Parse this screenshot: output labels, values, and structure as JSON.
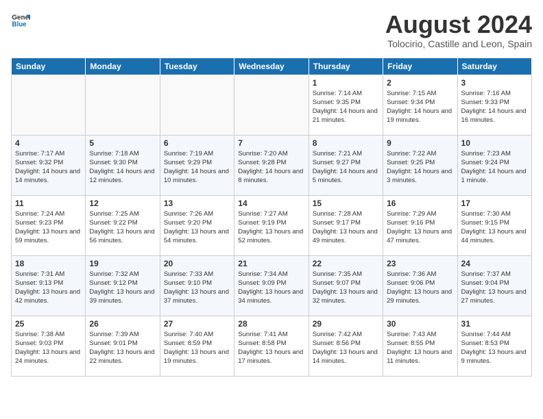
{
  "header": {
    "logo": "GeneralBlue",
    "month_title": "August 2024",
    "location": "Tolocirio, Castille and Leon, Spain"
  },
  "weekdays": [
    "Sunday",
    "Monday",
    "Tuesday",
    "Wednesday",
    "Thursday",
    "Friday",
    "Saturday"
  ],
  "weeks": [
    [
      {
        "day": "",
        "info": ""
      },
      {
        "day": "",
        "info": ""
      },
      {
        "day": "",
        "info": ""
      },
      {
        "day": "",
        "info": ""
      },
      {
        "day": "1",
        "info": "Sunrise: 7:14 AM\nSunset: 9:35 PM\nDaylight: 14 hours\nand 21 minutes."
      },
      {
        "day": "2",
        "info": "Sunrise: 7:15 AM\nSunset: 9:34 PM\nDaylight: 14 hours\nand 19 minutes."
      },
      {
        "day": "3",
        "info": "Sunrise: 7:16 AM\nSunset: 9:33 PM\nDaylight: 14 hours\nand 16 minutes."
      }
    ],
    [
      {
        "day": "4",
        "info": "Sunrise: 7:17 AM\nSunset: 9:32 PM\nDaylight: 14 hours\nand 14 minutes."
      },
      {
        "day": "5",
        "info": "Sunrise: 7:18 AM\nSunset: 9:30 PM\nDaylight: 14 hours\nand 12 minutes."
      },
      {
        "day": "6",
        "info": "Sunrise: 7:19 AM\nSunset: 9:29 PM\nDaylight: 14 hours\nand 10 minutes."
      },
      {
        "day": "7",
        "info": "Sunrise: 7:20 AM\nSunset: 9:28 PM\nDaylight: 14 hours\nand 8 minutes."
      },
      {
        "day": "8",
        "info": "Sunrise: 7:21 AM\nSunset: 9:27 PM\nDaylight: 14 hours\nand 5 minutes."
      },
      {
        "day": "9",
        "info": "Sunrise: 7:22 AM\nSunset: 9:25 PM\nDaylight: 14 hours\nand 3 minutes."
      },
      {
        "day": "10",
        "info": "Sunrise: 7:23 AM\nSunset: 9:24 PM\nDaylight: 14 hours\nand 1 minute."
      }
    ],
    [
      {
        "day": "11",
        "info": "Sunrise: 7:24 AM\nSunset: 9:23 PM\nDaylight: 13 hours\nand 59 minutes."
      },
      {
        "day": "12",
        "info": "Sunrise: 7:25 AM\nSunset: 9:22 PM\nDaylight: 13 hours\nand 56 minutes."
      },
      {
        "day": "13",
        "info": "Sunrise: 7:26 AM\nSunset: 9:20 PM\nDaylight: 13 hours\nand 54 minutes."
      },
      {
        "day": "14",
        "info": "Sunrise: 7:27 AM\nSunset: 9:19 PM\nDaylight: 13 hours\nand 52 minutes."
      },
      {
        "day": "15",
        "info": "Sunrise: 7:28 AM\nSunset: 9:17 PM\nDaylight: 13 hours\nand 49 minutes."
      },
      {
        "day": "16",
        "info": "Sunrise: 7:29 AM\nSunset: 9:16 PM\nDaylight: 13 hours\nand 47 minutes."
      },
      {
        "day": "17",
        "info": "Sunrise: 7:30 AM\nSunset: 9:15 PM\nDaylight: 13 hours\nand 44 minutes."
      }
    ],
    [
      {
        "day": "18",
        "info": "Sunrise: 7:31 AM\nSunset: 9:13 PM\nDaylight: 13 hours\nand 42 minutes."
      },
      {
        "day": "19",
        "info": "Sunrise: 7:32 AM\nSunset: 9:12 PM\nDaylight: 13 hours\nand 39 minutes."
      },
      {
        "day": "20",
        "info": "Sunrise: 7:33 AM\nSunset: 9:10 PM\nDaylight: 13 hours\nand 37 minutes."
      },
      {
        "day": "21",
        "info": "Sunrise: 7:34 AM\nSunset: 9:09 PM\nDaylight: 13 hours\nand 34 minutes."
      },
      {
        "day": "22",
        "info": "Sunrise: 7:35 AM\nSunset: 9:07 PM\nDaylight: 13 hours\nand 32 minutes."
      },
      {
        "day": "23",
        "info": "Sunrise: 7:36 AM\nSunset: 9:06 PM\nDaylight: 13 hours\nand 29 minutes."
      },
      {
        "day": "24",
        "info": "Sunrise: 7:37 AM\nSunset: 9:04 PM\nDaylight: 13 hours\nand 27 minutes."
      }
    ],
    [
      {
        "day": "25",
        "info": "Sunrise: 7:38 AM\nSunset: 9:03 PM\nDaylight: 13 hours\nand 24 minutes."
      },
      {
        "day": "26",
        "info": "Sunrise: 7:39 AM\nSunset: 9:01 PM\nDaylight: 13 hours\nand 22 minutes."
      },
      {
        "day": "27",
        "info": "Sunrise: 7:40 AM\nSunset: 8:59 PM\nDaylight: 13 hours\nand 19 minutes."
      },
      {
        "day": "28",
        "info": "Sunrise: 7:41 AM\nSunset: 8:58 PM\nDaylight: 13 hours\nand 17 minutes."
      },
      {
        "day": "29",
        "info": "Sunrise: 7:42 AM\nSunset: 8:56 PM\nDaylight: 13 hours\nand 14 minutes."
      },
      {
        "day": "30",
        "info": "Sunrise: 7:43 AM\nSunset: 8:55 PM\nDaylight: 13 hours\nand 11 minutes."
      },
      {
        "day": "31",
        "info": "Sunrise: 7:44 AM\nSunset: 8:53 PM\nDaylight: 13 hours\nand 9 minutes."
      }
    ]
  ]
}
